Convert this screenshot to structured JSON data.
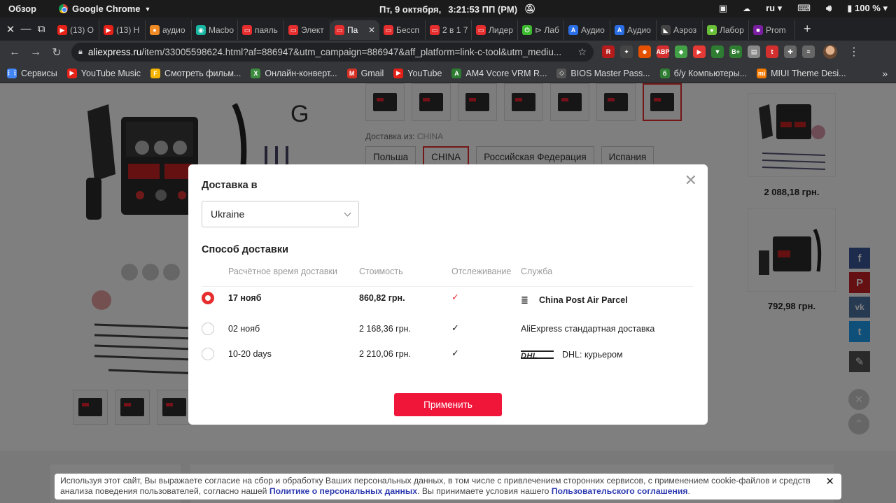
{
  "os": {
    "overview": "Обзор",
    "app_name": "Google Chrome",
    "date": "Пт, 9 октября,",
    "time": "3:21:53 ПП (PM)",
    "lang": "ru",
    "battery": "100 %"
  },
  "tabs": [
    {
      "label": "(13) О",
      "color": "#e62117",
      "glyph": "▶"
    },
    {
      "label": "(13) Н",
      "color": "#e62117",
      "glyph": "▶"
    },
    {
      "label": "аудио",
      "color": "#f08a24",
      "glyph": "●"
    },
    {
      "label": "Macbo",
      "color": "#19b7a3",
      "glyph": "◉"
    },
    {
      "label": "паяль",
      "color": "#e62e2e",
      "glyph": "▭"
    },
    {
      "label": "Элект",
      "color": "#e62e2e",
      "glyph": "▭"
    },
    {
      "label": "Па",
      "color": "#e62e2e",
      "glyph": "▭",
      "active": true
    },
    {
      "label": "Бессп",
      "color": "#e62e2e",
      "glyph": "▭"
    },
    {
      "label": "2 в 1 7",
      "color": "#e62e2e",
      "glyph": "▭"
    },
    {
      "label": "Лидер",
      "color": "#e62e2e",
      "glyph": "▭"
    },
    {
      "label": "⊳ Лаб",
      "color": "#3dbb2f",
      "glyph": "⏻"
    },
    {
      "label": "Аудио",
      "color": "#2a6ee6",
      "glyph": "A"
    },
    {
      "label": "Аудио",
      "color": "#2a6ee6",
      "glyph": "A"
    },
    {
      "label": "Аэроз",
      "color": "#444444",
      "glyph": "◣"
    },
    {
      "label": "Лабор",
      "color": "#6abf3a",
      "glyph": "●"
    },
    {
      "label": "Prom",
      "color": "#7b1fa2",
      "glyph": "■"
    }
  ],
  "toolbar": {
    "url_host": "aliexpress.ru",
    "url_rest": "/item/33005598624.html?af=886947&utm_campaign=886947&aff_platform=link-c-tool&utm_mediu..."
  },
  "extensions": [
    {
      "name": "ext-red-monitor",
      "color": "#b71c1c",
      "glyph": "R"
    },
    {
      "name": "ext-fox",
      "color": "#444444",
      "glyph": "✦"
    },
    {
      "name": "ext-orange",
      "color": "#e65100",
      "glyph": "☻"
    },
    {
      "name": "ext-adblock",
      "color": "#d32f2f",
      "glyph": "ABP"
    },
    {
      "name": "ext-green",
      "color": "#43a047",
      "glyph": "◆"
    },
    {
      "name": "ext-red-play",
      "color": "#e53935",
      "glyph": "▶"
    },
    {
      "name": "ext-vpn",
      "color": "#2e7d32",
      "glyph": "▼"
    },
    {
      "name": "ext-bplus",
      "color": "#2e7d32",
      "glyph": "B+"
    },
    {
      "name": "ext-print",
      "color": "#888888",
      "glyph": "▤"
    },
    {
      "name": "ext-t",
      "color": "#d32f2f",
      "glyph": "t"
    },
    {
      "name": "ext-puzzle",
      "color": "#666666",
      "glyph": "✚"
    },
    {
      "name": "ext-media",
      "color": "#666666",
      "glyph": "≡"
    }
  ],
  "bookmarks": [
    {
      "label": "Сервисы",
      "color": "#4285f4",
      "glyph": "⋮⋮"
    },
    {
      "label": "YouTube Music",
      "color": "#e62117",
      "glyph": "▶"
    },
    {
      "label": "Смотреть фильм...",
      "color": "#f4b400",
      "glyph": "F"
    },
    {
      "label": "Онлайн-конверт...",
      "color": "#3d8c40",
      "glyph": "X"
    },
    {
      "label": "Gmail",
      "color": "#d93025",
      "glyph": "M"
    },
    {
      "label": "YouTube",
      "color": "#e62117",
      "glyph": "▶"
    },
    {
      "label": "AM4 Vcore VRM R...",
      "color": "#2e7d32",
      "glyph": "A"
    },
    {
      "label": "BIOS Master Pass...",
      "color": "#555555",
      "glyph": "◇"
    },
    {
      "label": "б/у Компьютеры...",
      "color": "#2e7d32",
      "glyph": "б"
    },
    {
      "label": "MIUI Theme Desi...",
      "color": "#f57c00",
      "glyph": "mi"
    }
  ],
  "page": {
    "letter": "G",
    "ship_from_label": "Доставка из:",
    "ship_from_value": "CHINA",
    "countries": [
      "Польша",
      "CHINA",
      "Российская Федерация",
      "Испания"
    ],
    "side_prices": [
      "2 088,18 грн.",
      "792,98 грн."
    ]
  },
  "modal": {
    "title": "Доставка в",
    "country": "Ukraine",
    "method_title": "Способ доставки",
    "columns": {
      "time": "Расчётное время доставки",
      "cost": "Стоимость",
      "tracking": "Отслеживание",
      "service": "Служба"
    },
    "rows": [
      {
        "date": "17 нояб",
        "cost": "860,82 грн.",
        "service": "China Post Air Parcel",
        "selected": true
      },
      {
        "date": "02 нояб",
        "cost": "2 168,36 грн.",
        "service": "AliExpress стандартная доставка",
        "selected": false
      },
      {
        "date": "10-20 days",
        "cost": "2 210,06 грн.",
        "service": "DHL: курьером",
        "selected": false
      }
    ],
    "dhl_logo": "DHL",
    "apply": "Применить"
  },
  "cookie": {
    "text1": "Используя этот сайт, Вы выражаете согласие на сбор и обработку Ваших персональных данных, в том числе с привлечением сторонних сервисов, с применением cookie-файлов и средств анализа поведения пользователей, согласно нашей ",
    "link1": "Политике о персональных данных",
    "text2": ". Вы принимаете условия нашего ",
    "link2": "Пользовательского соглашения",
    "text3": "."
  },
  "colors": {
    "accent": "#e62e2e",
    "apply": "#f0163a"
  }
}
